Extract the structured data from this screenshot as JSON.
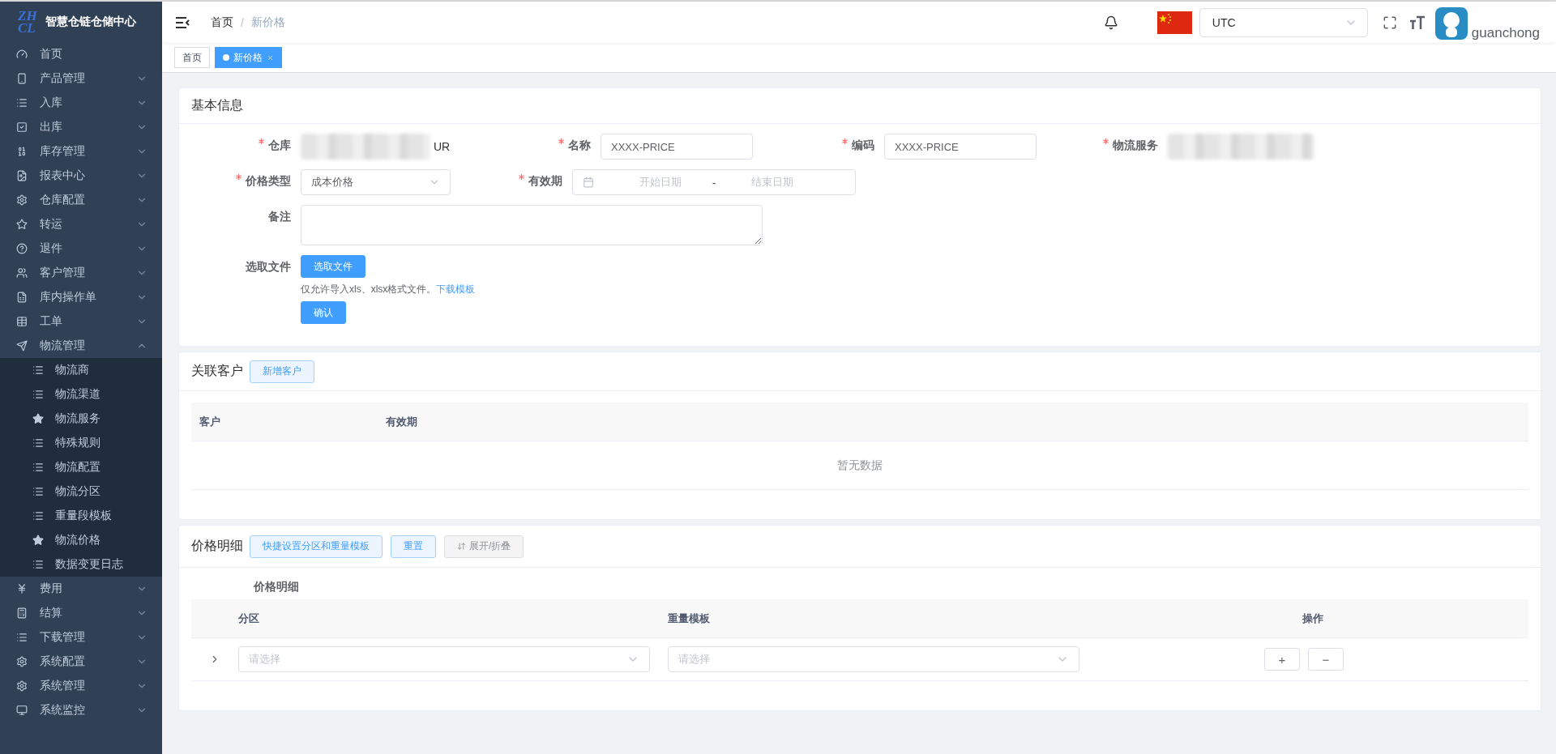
{
  "sidebar": {
    "logo_letters": [
      "ZH",
      "CL"
    ],
    "title": "智慧仓链仓储中心",
    "items": [
      {
        "label": "首页"
      },
      {
        "label": "产品管理",
        "expanded": false
      },
      {
        "label": "入库",
        "expanded": false
      },
      {
        "label": "出库",
        "expanded": false
      },
      {
        "label": "库存管理",
        "expanded": false
      },
      {
        "label": "报表中心",
        "expanded": false
      },
      {
        "label": "仓库配置",
        "expanded": false
      },
      {
        "label": "转运",
        "expanded": false
      },
      {
        "label": "退件",
        "expanded": false
      },
      {
        "label": "客户管理",
        "expanded": false
      },
      {
        "label": "库内操作单",
        "expanded": false
      },
      {
        "label": "工单",
        "expanded": false
      },
      {
        "label": "物流管理",
        "expanded": true,
        "children": [
          {
            "label": "物流商",
            "kind": "list"
          },
          {
            "label": "物流渠道",
            "kind": "list"
          },
          {
            "label": "物流服务",
            "kind": "star"
          },
          {
            "label": "特殊规则",
            "kind": "list"
          },
          {
            "label": "物流配置",
            "kind": "list"
          },
          {
            "label": "物流分区",
            "kind": "list"
          },
          {
            "label": "重量段模板",
            "kind": "list"
          },
          {
            "label": "物流价格",
            "kind": "star"
          },
          {
            "label": "数据变更日志",
            "kind": "list"
          }
        ]
      },
      {
        "label": "费用",
        "expanded": false
      },
      {
        "label": "结算",
        "expanded": false
      },
      {
        "label": "下载管理",
        "expanded": false
      },
      {
        "label": "系统配置",
        "expanded": false
      },
      {
        "label": "系统管理",
        "expanded": false
      },
      {
        "label": "系统监控",
        "expanded": false
      }
    ]
  },
  "header": {
    "breadcrumb": [
      "首页",
      "新价格"
    ],
    "breadcrumb_separator": "/",
    "timezone": "UTC",
    "username": "guanchong"
  },
  "tabs": [
    {
      "label": "首页",
      "selected": false
    },
    {
      "label": "新价格",
      "selected": true
    }
  ],
  "basic_info": {
    "title": "基本信息",
    "rows": [
      [
        {
          "kind": "blurred",
          "label": "仓库",
          "required": true,
          "value": "UR"
        },
        {
          "kind": "input",
          "label": "名称",
          "required": true,
          "value": "XXXX-PRICE"
        },
        {
          "kind": "input",
          "label": "编码",
          "required": true,
          "value": "XXXX-PRICE"
        },
        {
          "kind": "blurred",
          "label": "物流服务",
          "required": true
        }
      ],
      [
        {
          "kind": "select",
          "label": "价格类型",
          "required": true,
          "value": "成本价格"
        },
        {
          "kind": "daterange",
          "label": "有效期",
          "required": true,
          "start_placeholder": "开始日期",
          "separator": "-",
          "end_placeholder": "结束日期"
        }
      ],
      [
        {
          "kind": "textarea",
          "label": "备注",
          "required": false
        }
      ],
      [
        {
          "kind": "file",
          "label": "选取文件",
          "required": false,
          "button": "选取文件",
          "hint": "仅允许导入xls、xlsx格式文件。",
          "link": "下载模板",
          "confirm": "确认"
        }
      ]
    ]
  },
  "customers": {
    "title": "关联客户",
    "add_button": "新增客户",
    "columns": [
      "客户",
      "有效期"
    ],
    "empty_text": "暂无数据"
  },
  "price_detail": {
    "title": "价格明细",
    "buttons": [
      {
        "label": "快捷设置分区和重量模板",
        "kind": "primary"
      },
      {
        "label": "重置",
        "kind": "primary"
      },
      {
        "label": "展开/折叠",
        "kind": "default"
      }
    ],
    "subtitle": "价格明细",
    "columns": [
      "分区",
      "重量模板",
      "操作"
    ],
    "rows": [
      {
        "zone_placeholder": "请选择",
        "weight_placeholder": "请选择",
        "actions": [
          "+",
          "−"
        ]
      }
    ]
  }
}
